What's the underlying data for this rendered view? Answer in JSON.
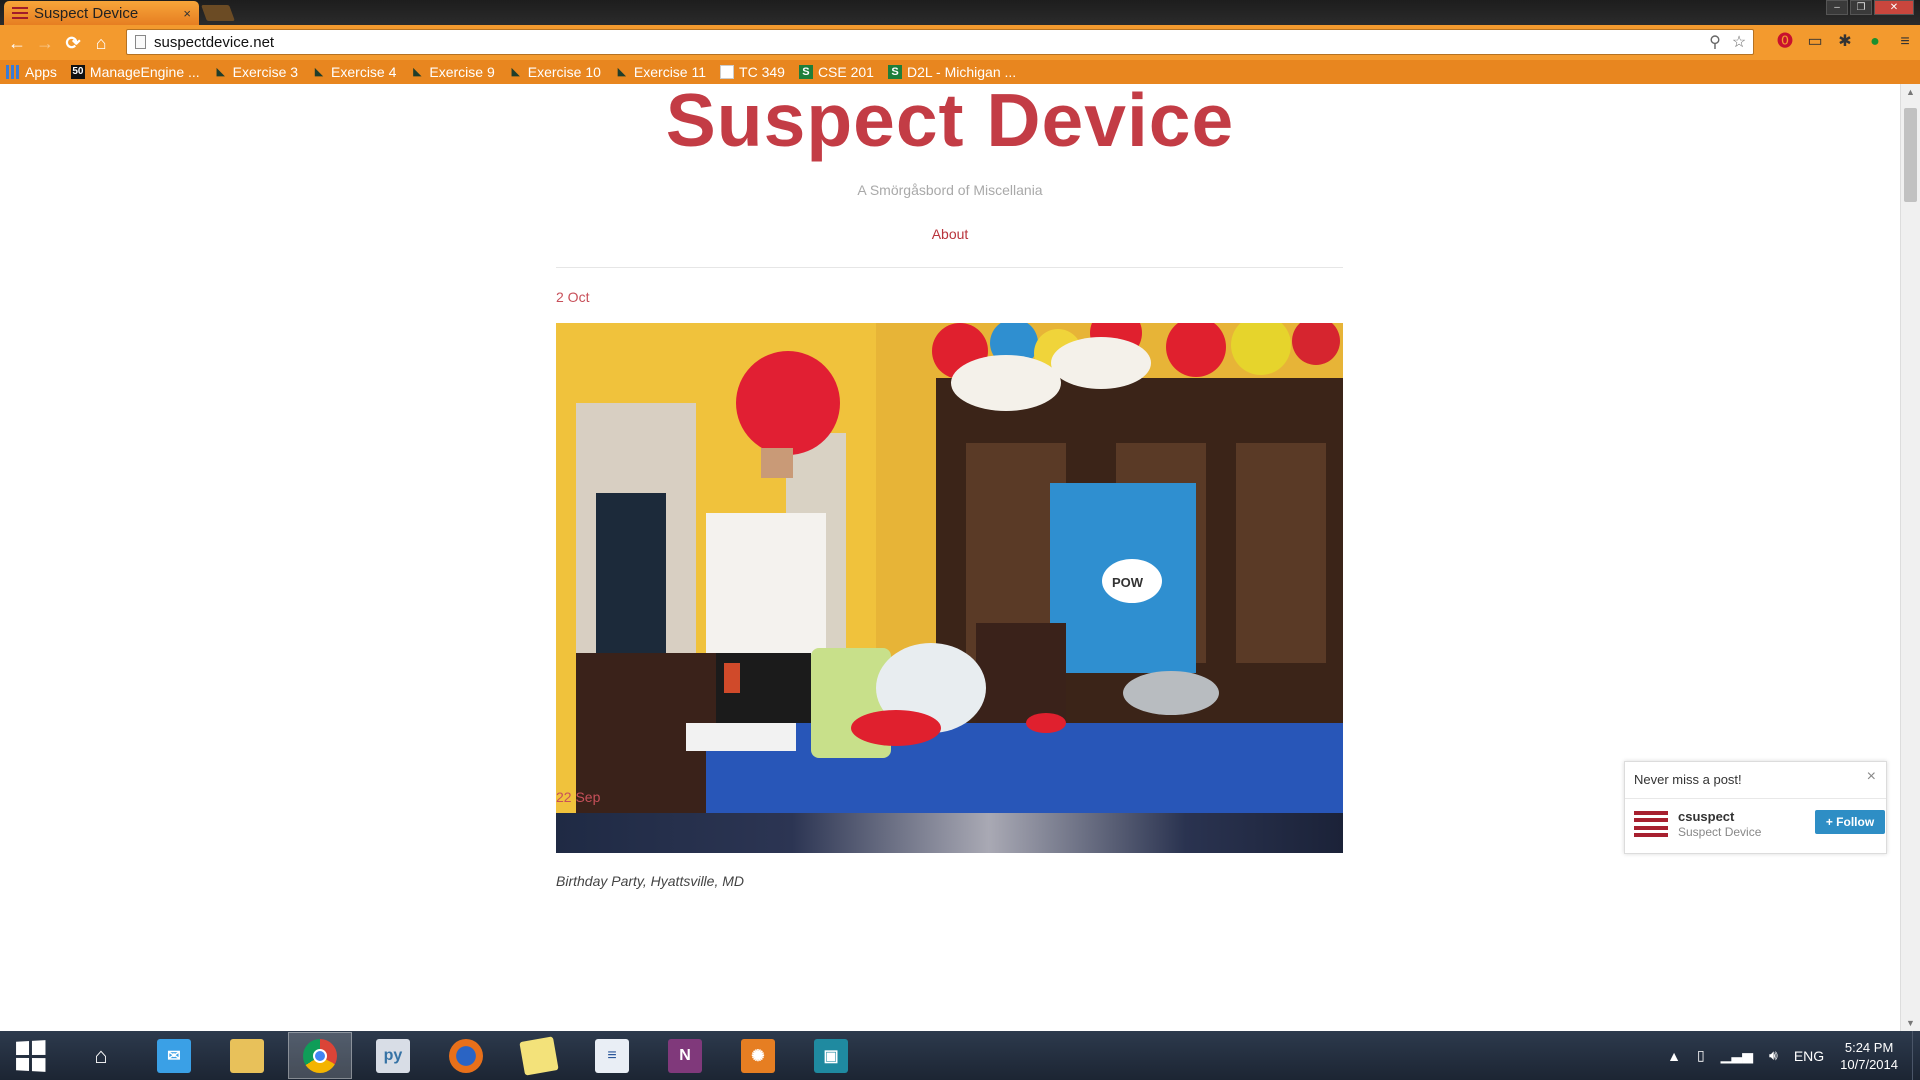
{
  "browser": {
    "tab_title": "Suspect Device",
    "tab_close": "×",
    "url": "suspectdevice.net",
    "window_controls": [
      "–",
      "❐",
      "✕"
    ],
    "nav": {
      "back": "←",
      "forward": "→",
      "reload": "⟳",
      "home": "⌂"
    },
    "omnibox_icons": {
      "search": "⚲",
      "star": "☆"
    },
    "extensions": [
      {
        "name": "adblock-icon",
        "glyph": "⓿"
      },
      {
        "name": "cast-icon",
        "glyph": "▭"
      },
      {
        "name": "settings-gear-icon",
        "glyph": "✱"
      },
      {
        "name": "shield-extension-icon",
        "glyph": "●"
      },
      {
        "name": "menu-icon",
        "glyph": "≡"
      }
    ],
    "bookmarks": [
      {
        "label": "Apps",
        "icon": "apps"
      },
      {
        "label": "ManageEngine ...",
        "icon": "me"
      },
      {
        "label": "Exercise 3",
        "icon": "msu"
      },
      {
        "label": "Exercise 4",
        "icon": "msu"
      },
      {
        "label": "Exercise 9",
        "icon": "msu"
      },
      {
        "label": "Exercise 10",
        "icon": "msu"
      },
      {
        "label": "Exercise 11",
        "icon": "msu"
      },
      {
        "label": "TC 349",
        "icon": "doc"
      },
      {
        "label": "CSE 201",
        "icon": "s"
      },
      {
        "label": "D2L - Michigan ...",
        "icon": "s"
      }
    ]
  },
  "site": {
    "title": "Suspect Device",
    "tagline": "A Smörgåsbord of Miscellania",
    "nav": {
      "about": "About"
    }
  },
  "posts": [
    {
      "date": "2 Oct",
      "caption": "Birthday Party, Hyattsville, MD"
    },
    {
      "date": "22 Sep"
    }
  ],
  "follow_widget": {
    "title": "Never miss a post!",
    "close": "×",
    "username": "csuspect",
    "site_name": "Suspect Device",
    "button": "+ Follow"
  },
  "taskbar": {
    "apps": [
      {
        "name": "home-app"
      },
      {
        "name": "mail-app"
      },
      {
        "name": "file-explorer-app"
      },
      {
        "name": "chrome-app",
        "active": true
      },
      {
        "name": "python-app"
      },
      {
        "name": "firefox-app"
      },
      {
        "name": "sticky-notes-app"
      },
      {
        "name": "writer-app"
      },
      {
        "name": "onenote-app"
      },
      {
        "name": "settings-app"
      },
      {
        "name": "photo-app"
      }
    ],
    "tray": {
      "language": "ENG",
      "time": "5:24 PM",
      "date": "10/7/2014",
      "show_hidden": "▲"
    }
  },
  "colors": {
    "brand_red": "#c33c45",
    "chrome_orange": "#f39a2e",
    "follow_blue": "#2e8ec5"
  }
}
